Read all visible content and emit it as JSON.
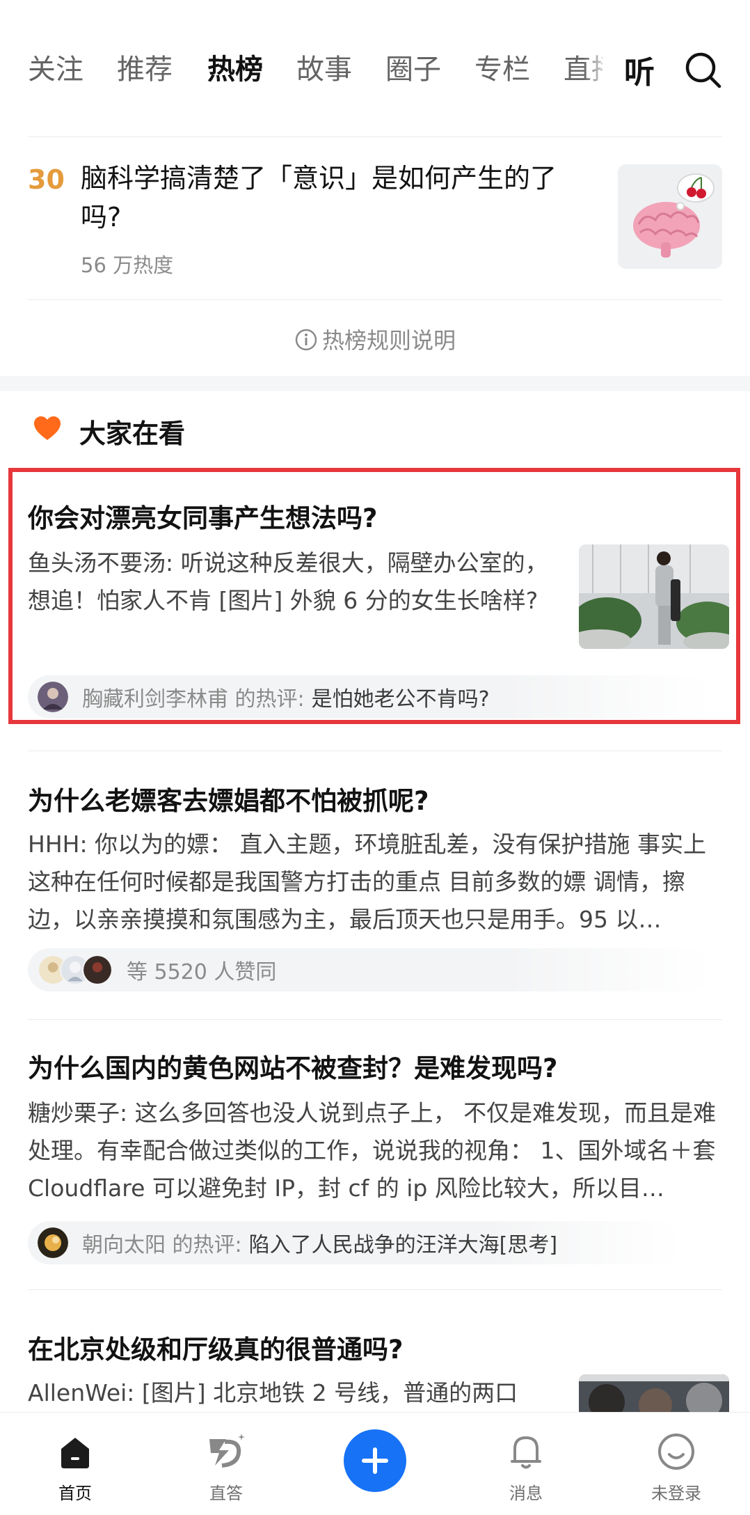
{
  "tabs": [
    {
      "label": "关注"
    },
    {
      "label": "推荐"
    },
    {
      "label": "热榜"
    },
    {
      "label": "故事"
    },
    {
      "label": "圈子"
    },
    {
      "label": "专栏"
    },
    {
      "label": "直播"
    }
  ],
  "listen_label": "听",
  "hot_item": {
    "rank": "30",
    "title": "脑科学搞清楚了「意识」是如何产生的了吗?",
    "heat": "56 万热度"
  },
  "rules_label": "热榜规则说明",
  "section_title": "大家在看",
  "cards": [
    {
      "title": "你会对漂亮女同事产生想法吗?",
      "excerpt": "鱼头汤不要汤: 听说这种反差很大，隔壁办公室的，想追！怕家人不肯 [图片] 外貌 6 分的女生长啥样?",
      "comment_user": "胸藏利剑李林甫 的热评:",
      "comment_text": "是怕她老公不肯吗?"
    },
    {
      "title": "为什么老嫖客去嫖娼都不怕被抓呢?",
      "excerpt": "HHH: 你以为的嫖：  直入主题，环境脏乱差，没有保护措施 事实上这种在任何时候都是我国警方打击的重点 目前多数的嫖 调情，擦边，以亲亲摸摸和氛围感为主，最后顶天也只是用手。95 以…",
      "agree_text": "等 5520 人赞同"
    },
    {
      "title": "为什么国内的黄色网站不被查封？是难发现吗?",
      "excerpt": "糖炒栗子: 这么多回答也没人说到点子上，  不仅是难发现，而且是难处理。有幸配合做过类似的工作，说说我的视角：  1、国外域名＋套 Cloudflare 可以避免封 IP，封 cf 的 ip 风险比较大，所以目…",
      "comment_user": "朝向太阳 的热评:",
      "comment_text": "陷入了人民战争的汪洋大海[思考]"
    },
    {
      "title": "在北京处级和厅级真的很普通吗?",
      "excerpt": "AllenWei: [图片] 北京地铁 2 号线，普通的两口"
    }
  ],
  "nav": [
    {
      "label": "首页",
      "icon": "home-icon"
    },
    {
      "label": "直答",
      "icon": "zhida-icon"
    },
    {
      "label": "",
      "icon": "add-icon"
    },
    {
      "label": "消息",
      "icon": "bell-icon"
    },
    {
      "label": "未登录",
      "icon": "profile-icon"
    }
  ],
  "colors": {
    "accent_blue": "#1772f6",
    "rank_orange": "#e59b3b",
    "highlight_red": "#e6373d",
    "heart_orange": "#ff6a1a"
  }
}
